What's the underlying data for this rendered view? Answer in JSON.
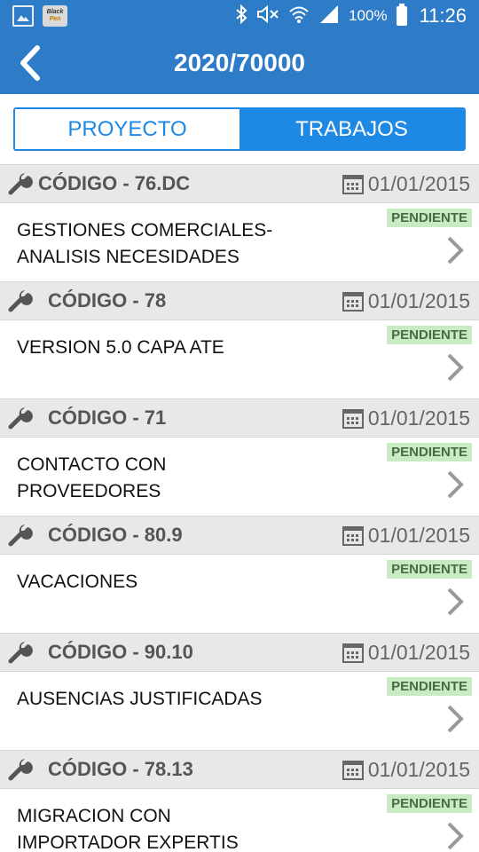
{
  "status_bar": {
    "battery_percent": "100%",
    "time": "11:26",
    "app_icon_text_line1": "Black",
    "app_icon_text_line2": "Pen"
  },
  "app_bar": {
    "title": "2020/70000"
  },
  "tabs": [
    {
      "label": "PROYECTO",
      "active": false
    },
    {
      "label": "TRABAJOS",
      "active": true
    }
  ],
  "items": [
    {
      "code": "CÓDIGO - 76.DC",
      "date": "01/01/2015",
      "title": "GESTIONES COMERCIALES-\nANALISIS NECESIDADES",
      "status": "PENDIENTE"
    },
    {
      "code": "CÓDIGO - 78",
      "date": "01/01/2015",
      "title": "VERSION 5.0 CAPA ATE",
      "status": "PENDIENTE"
    },
    {
      "code": "CÓDIGO - 71",
      "date": "01/01/2015",
      "title": "CONTACTO CON\nPROVEEDORES",
      "status": "PENDIENTE"
    },
    {
      "code": "CÓDIGO - 80.9",
      "date": "01/01/2015",
      "title": "VACACIONES",
      "status": "PENDIENTE"
    },
    {
      "code": "CÓDIGO - 90.10",
      "date": "01/01/2015",
      "title": "AUSENCIAS JUSTIFICADAS",
      "status": "PENDIENTE"
    },
    {
      "code": "CÓDIGO - 78.13",
      "date": "01/01/2015",
      "title": "MIGRACION CON\nIMPORTADOR EXPERTIS",
      "status": "PENDIENTE"
    }
  ],
  "colors": {
    "primary": "#2e7bc8",
    "accent": "#1e88e5",
    "badge_bg": "#c8ebc3",
    "header_bg": "#e8e8e8"
  }
}
